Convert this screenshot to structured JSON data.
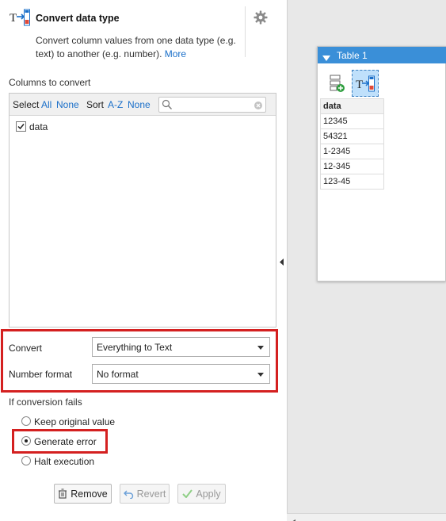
{
  "header": {
    "title": "Convert data type",
    "description": "Convert column values from one data type (e.g. text) to another (e.g. number).",
    "more_link": "More"
  },
  "columns": {
    "section_label": "Columns to convert",
    "select_label": "Select",
    "select_all": "All",
    "select_none": "None",
    "sort_label": "Sort",
    "sort_az": "A-Z",
    "sort_none": "None",
    "search_placeholder": "",
    "items": [
      {
        "label": "data",
        "checked": true
      }
    ]
  },
  "options": {
    "convert_label": "Convert",
    "convert_value": "Everything to Text",
    "number_format_label": "Number format",
    "number_format_value": "No format"
  },
  "failure": {
    "section_label": "If conversion fails",
    "options": [
      {
        "label": "Keep original value",
        "selected": false
      },
      {
        "label": "Generate error",
        "selected": true
      },
      {
        "label": "Halt execution",
        "selected": false
      }
    ]
  },
  "buttons": {
    "remove": "Remove",
    "revert": "Revert",
    "apply": "Apply"
  },
  "table_widget": {
    "title": "Table 1",
    "column_header": "data",
    "rows": [
      "12345",
      "54321",
      "1-2345",
      "12-345",
      "123-45"
    ]
  },
  "colors": {
    "accent": "#1a6fc9",
    "highlight": "#d42020",
    "widget_header": "#3a8fd8"
  }
}
